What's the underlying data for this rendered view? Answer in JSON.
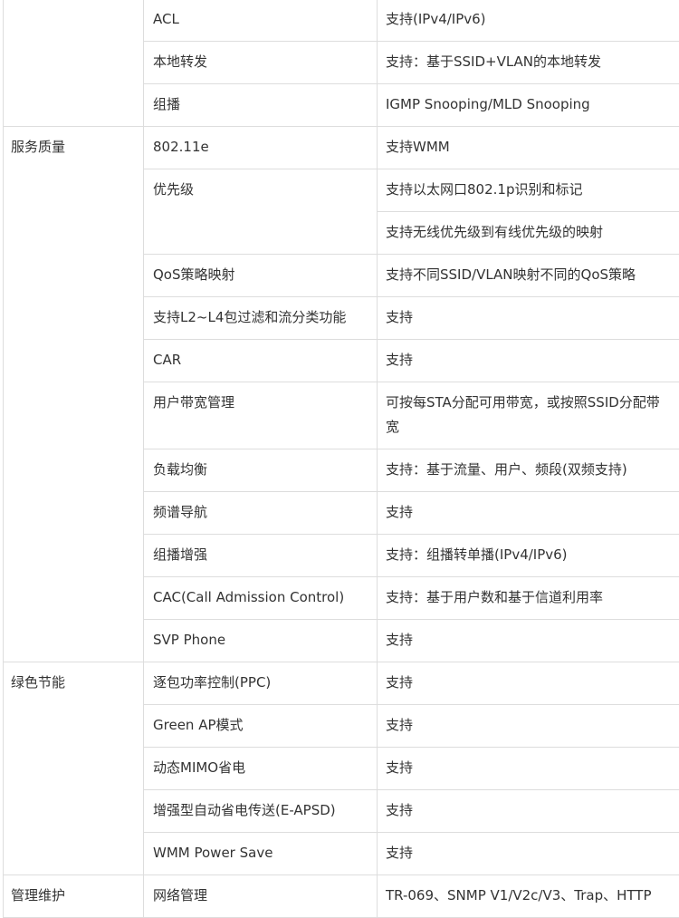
{
  "rows": [
    {
      "category": "",
      "feature": "ACL",
      "values": [
        "支持(IPv4/IPv6)"
      ]
    },
    {
      "feature": "本地转发",
      "values": [
        "支持：基于SSID+VLAN的本地转发"
      ]
    },
    {
      "feature": "组播",
      "values": [
        "IGMP Snooping/MLD Snooping"
      ]
    },
    {
      "category": "服务质量",
      "feature": "802.11e",
      "values": [
        "支持WMM"
      ]
    },
    {
      "feature": "优先级",
      "values": [
        "支持以太网口802.1p识别和标记",
        "支持无线优先级到有线优先级的映射"
      ]
    },
    {
      "feature": "QoS策略映射",
      "values": [
        "支持不同SSID/VLAN映射不同的QoS策略"
      ]
    },
    {
      "feature": "支持L2~L4包过滤和流分类功能",
      "values": [
        "支持"
      ]
    },
    {
      "feature": "CAR",
      "values": [
        "支持"
      ]
    },
    {
      "feature": "用户带宽管理",
      "values": [
        "可按每STA分配可用带宽，或按照SSID分配带宽"
      ]
    },
    {
      "feature": "负载均衡",
      "values": [
        "支持：基于流量、用户、频段(双频支持)"
      ]
    },
    {
      "feature": "频谱导航",
      "values": [
        "支持"
      ]
    },
    {
      "feature": "组播增强",
      "values": [
        "支持：组播转单播(IPv4/IPv6)"
      ]
    },
    {
      "feature": "CAC(Call Admission Control)",
      "values": [
        "支持：基于用户数和基于信道利用率"
      ]
    },
    {
      "feature": "SVP Phone",
      "values": [
        "支持"
      ]
    },
    {
      "category": "绿色节能",
      "feature": "逐包功率控制(PPC)",
      "values": [
        "支持"
      ]
    },
    {
      "feature": "Green AP模式",
      "values": [
        "支持"
      ]
    },
    {
      "feature": "动态MIMO省电",
      "values": [
        "支持"
      ]
    },
    {
      "feature": "增强型自动省电传送(E-APSD)",
      "values": [
        "支持"
      ]
    },
    {
      "feature": "WMM Power Save",
      "values": [
        "支持"
      ]
    },
    {
      "category": "管理维护",
      "feature": "网络管理",
      "values": [
        "TR-069、SNMP V1/V2c/V3、Trap、HTTP"
      ]
    }
  ]
}
